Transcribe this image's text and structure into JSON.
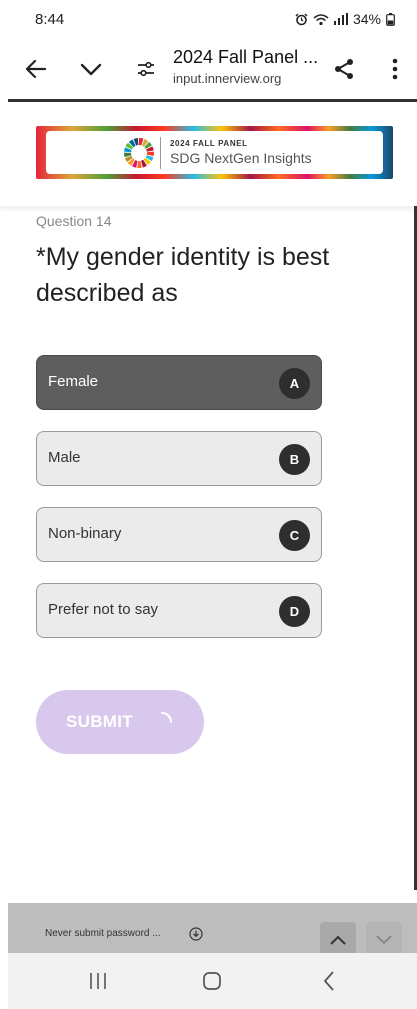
{
  "status_bar": {
    "time": "8:44",
    "battery": "34%",
    "icons": [
      "alarm-icon",
      "wifi-icon",
      "signal-icon",
      "battery-icon"
    ]
  },
  "browser": {
    "page_title": "2024 Fall Panel ...",
    "url": "input.innerview.org",
    "icons": [
      "back-arrow-icon",
      "chevron-down-icon",
      "tune-icon",
      "share-icon",
      "more-vertical-icon"
    ]
  },
  "banner": {
    "kicker": "2024 FALL PANEL",
    "name": "SDG NextGen Insights"
  },
  "question": {
    "number": "Question 14",
    "text": "*My gender identity is best described as",
    "options": [
      {
        "label": "Female",
        "key": "A",
        "selected": true
      },
      {
        "label": "Male",
        "key": "B",
        "selected": false
      },
      {
        "label": "Non-binary",
        "key": "C",
        "selected": false
      },
      {
        "label": "Prefer not to say",
        "key": "D",
        "selected": false
      }
    ],
    "submit_label": "SUBMIT"
  },
  "bottom_bar": {
    "note": "Never submit password ..."
  },
  "colors": {
    "selected_option": "#5e5e5e",
    "option_bg": "#ebebeb",
    "submit_bg": "#d8c8ee",
    "key_badge": "#2e2e2e"
  }
}
